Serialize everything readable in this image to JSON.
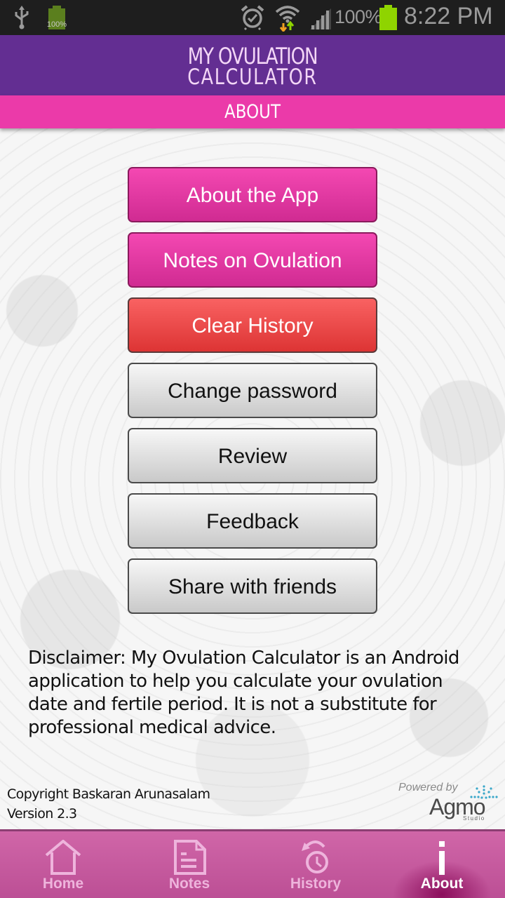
{
  "status_bar": {
    "small_battery_pct": "100%",
    "battery_pct": "100%",
    "time": "8:22 PM",
    "icons": [
      "usb-icon",
      "battery-icon",
      "alarm-icon",
      "wifi-icon",
      "signal-icon",
      "battery-icon"
    ],
    "battery_color": "#8fd400"
  },
  "header": {
    "title_line1": "MY OVULATION",
    "title_line2": "CALCULATOR",
    "section": "ABOUT",
    "colors": {
      "title_bar": "#632e92",
      "section_bar": "#eb3aa9"
    }
  },
  "menu": {
    "buttons": [
      {
        "label": "About the App",
        "style": "pink"
      },
      {
        "label": "Notes on Ovulation",
        "style": "pink"
      },
      {
        "label": "Clear History",
        "style": "red"
      },
      {
        "label": "Change password",
        "style": "gray"
      },
      {
        "label": "Review",
        "style": "gray"
      },
      {
        "label": "Feedback",
        "style": "gray"
      },
      {
        "label": "Share with friends",
        "style": "gray"
      }
    ]
  },
  "disclaimer": {
    "lines": [
      "Disclaimer: My Ovulation Calculator is an Android",
      "application to help you calculate your ovulation",
      "date and fertile period. It is not a substitute for",
      "professional medical advice."
    ]
  },
  "footer": {
    "copyright": "Copyright Baskaran Arunasalam",
    "version": "Version 2.3",
    "powered_by": "Powered by",
    "brand": "Agmo",
    "brand_sub": "Studio"
  },
  "bottom_nav": {
    "items": [
      {
        "label": "Home",
        "icon": "home-icon",
        "active": false
      },
      {
        "label": "Notes",
        "icon": "notes-icon",
        "active": false
      },
      {
        "label": "History",
        "icon": "history-icon",
        "active": false
      },
      {
        "label": "About",
        "icon": "info-icon",
        "active": true
      }
    ]
  }
}
